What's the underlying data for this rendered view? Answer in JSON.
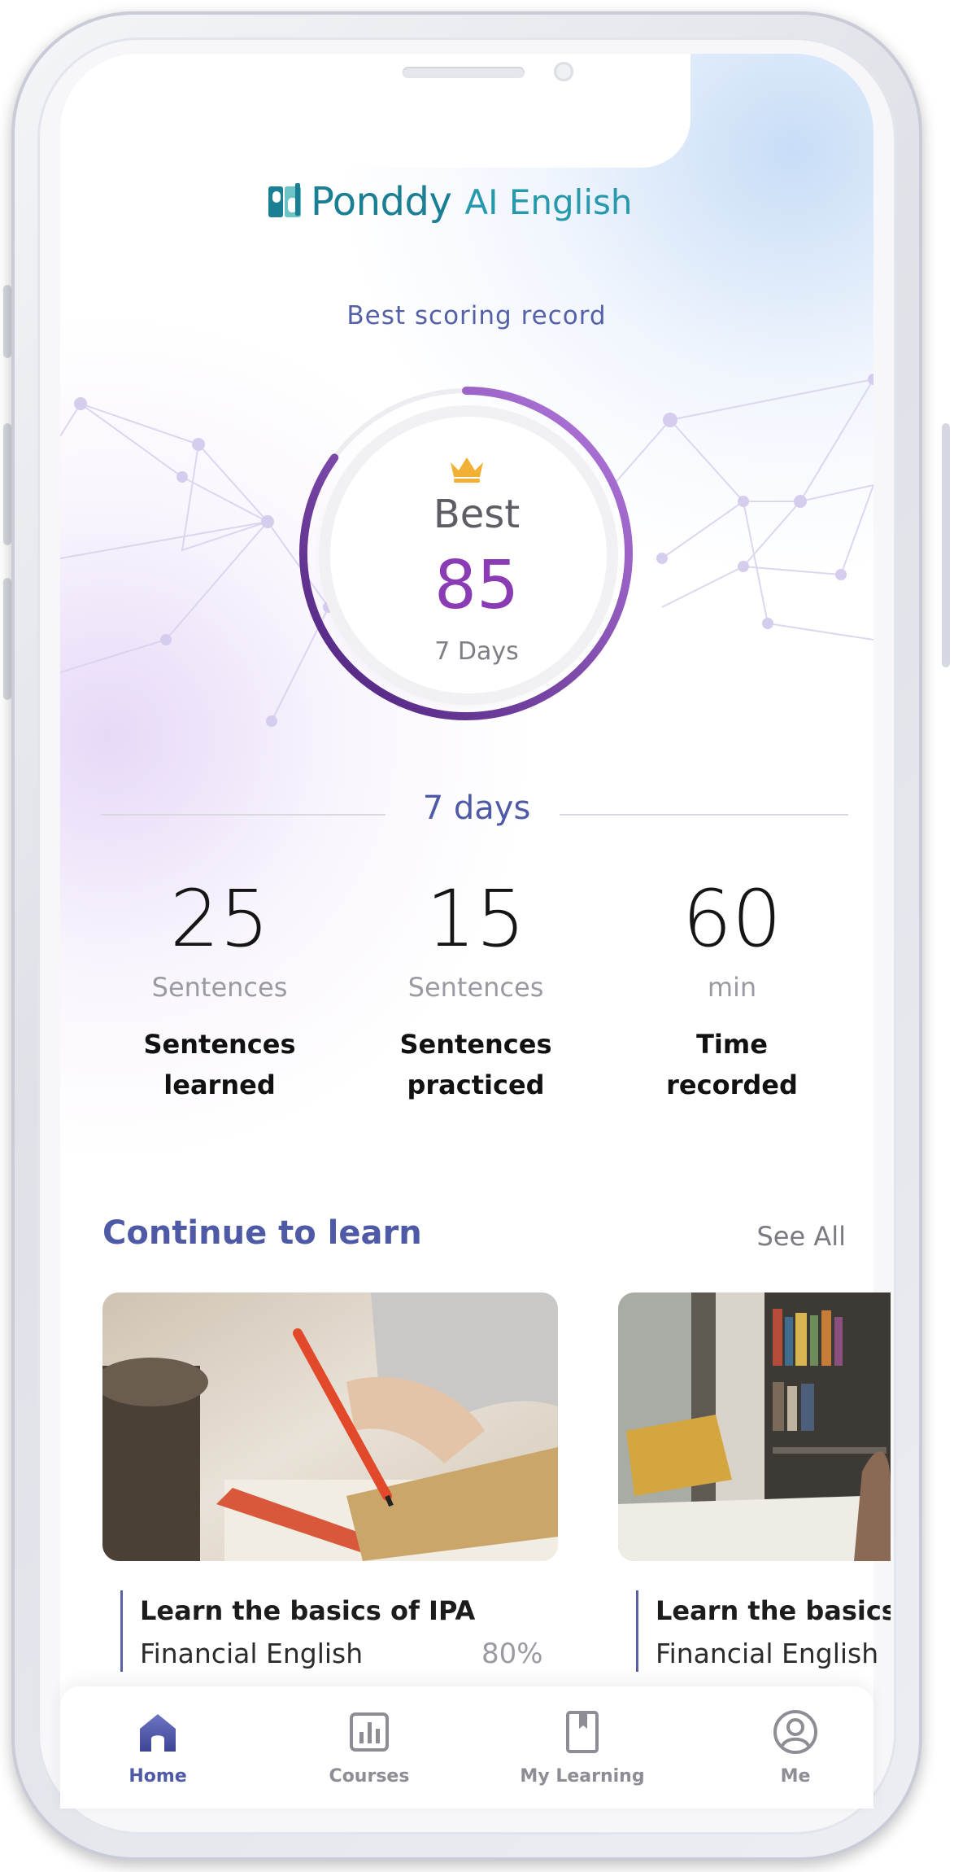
{
  "app": {
    "logo_name": "Ponddy",
    "logo_tagline": "AI English"
  },
  "record": {
    "label": "Best scoring record",
    "best_label": "Best",
    "best_value": "85",
    "period": "7 Days",
    "progress_fraction": 0.85
  },
  "summary": {
    "period_label": "7 days",
    "stats": [
      {
        "value": "25",
        "unit": "Sentences",
        "label_line1": "Sentences",
        "label_line2": "learned"
      },
      {
        "value": "15",
        "unit": "Sentences",
        "label_line1": "Sentences",
        "label_line2": "practiced"
      },
      {
        "value": "60",
        "unit": "min",
        "label_line1": "Time",
        "label_line2": "recorded"
      }
    ]
  },
  "continue": {
    "title": "Continue to learn",
    "see_all": "See All",
    "cards": [
      {
        "title": "Learn the basics of IPA",
        "subtitle": "Financial English",
        "progress": "80%",
        "image": "writing-notebook-photo"
      },
      {
        "title": "Learn the basics",
        "subtitle": "Financial English",
        "progress": "",
        "image": "bookshelf-reading-photo"
      }
    ]
  },
  "tabs": [
    {
      "label": "Home",
      "icon": "home-icon",
      "active": true
    },
    {
      "label": "Courses",
      "icon": "chart-icon",
      "active": false
    },
    {
      "label": "My Learning",
      "icon": "bookmark-icon",
      "active": false
    },
    {
      "label": "Me",
      "icon": "user-icon",
      "active": false
    }
  ],
  "colors": {
    "accent": "#4f5aa6",
    "score": "#8a3cb4",
    "ring_start": "#4a1f7a",
    "ring_end": "#b77be0",
    "logo": "#1b7f94"
  }
}
